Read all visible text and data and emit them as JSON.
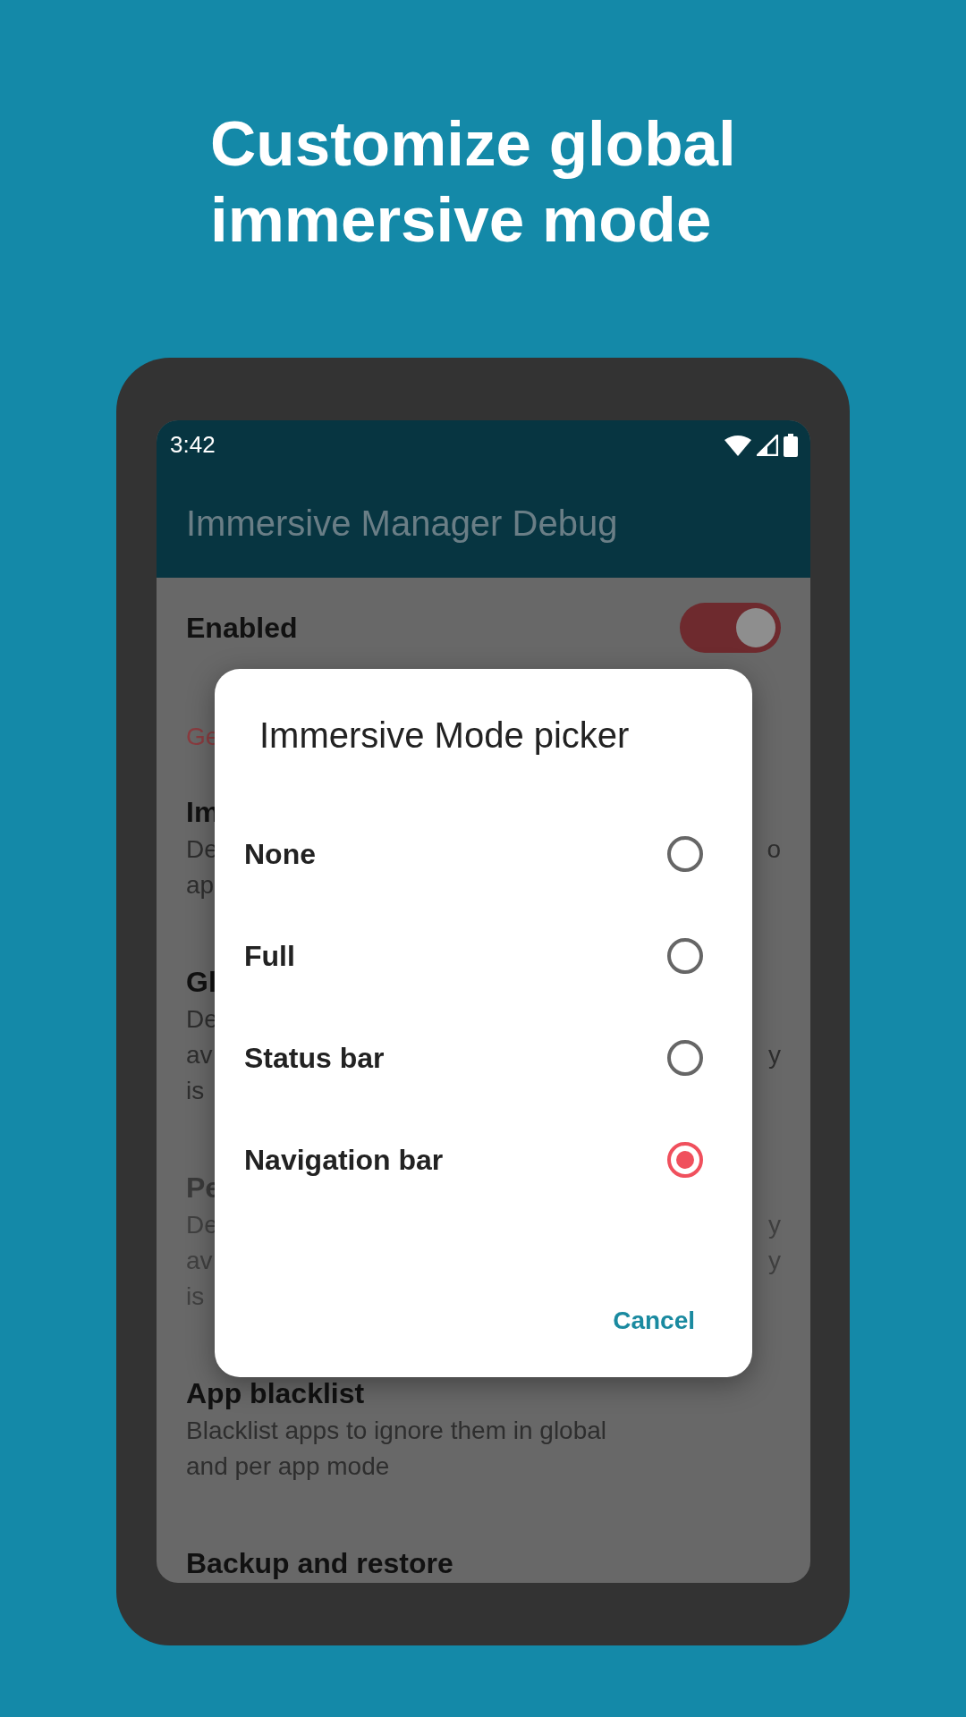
{
  "headline": "Customize global immersive mode",
  "status_bar": {
    "time": "3:42"
  },
  "app_bar": {
    "title": "Immersive Manager Debug"
  },
  "settings": [
    {
      "kind": "switch",
      "title": "Enabled",
      "on": true
    },
    {
      "kind": "header",
      "title": "Ge"
    },
    {
      "kind": "item",
      "disabled": false,
      "title": "Im",
      "summary_lines": [
        {
          "left": "De",
          "right": "o"
        },
        {
          "left": "ap"
        }
      ]
    },
    {
      "kind": "item",
      "disabled": false,
      "title": "Gl",
      "summary_lines": [
        {
          "left": "De"
        },
        {
          "left": "av",
          "right": "y"
        },
        {
          "left": "is"
        }
      ]
    },
    {
      "kind": "item",
      "disabled": true,
      "title": "Pe",
      "summary_lines": [
        {
          "left": "De",
          "right": "y"
        },
        {
          "left": "av",
          "right": "y"
        },
        {
          "left": "is"
        }
      ]
    },
    {
      "kind": "item",
      "disabled": false,
      "title": "App blacklist",
      "summary_lines": [
        {
          "left": "Blacklist apps to ignore them in global"
        },
        {
          "left": "and per app mode"
        }
      ]
    },
    {
      "kind": "item",
      "disabled": false,
      "title": "Backup and restore"
    }
  ],
  "dialog": {
    "title": "Immersive Mode picker",
    "options": [
      {
        "label": "None",
        "selected": false
      },
      {
        "label": "Full",
        "selected": false
      },
      {
        "label": "Status bar",
        "selected": false
      },
      {
        "label": "Navigation bar",
        "selected": true
      }
    ],
    "buttons": [
      "Cancel"
    ]
  }
}
